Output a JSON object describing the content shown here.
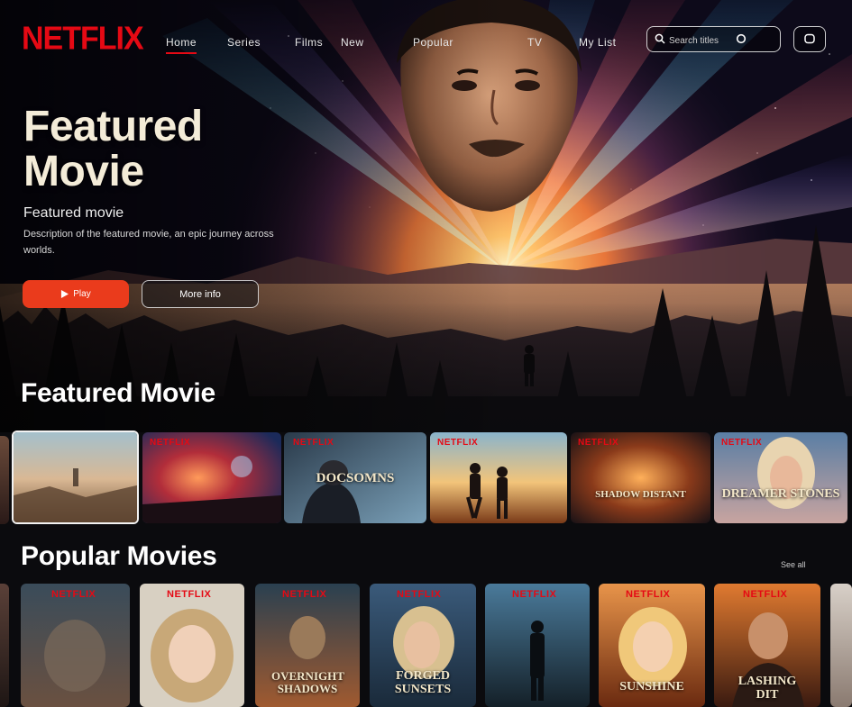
{
  "brand": {
    "logo": "NETFLIX",
    "accent": "#e50914"
  },
  "nav": {
    "links": [
      "Home",
      "Series",
      "Films",
      "New",
      "Popular",
      "TV",
      "My List"
    ]
  },
  "search": {
    "placeholder": "Search titles"
  },
  "hero": {
    "title": "Featured Movie",
    "subtitle": "Featured movie",
    "description": "Description of the featured movie, an epic journey across worlds.",
    "play_label": "Play",
    "more_label": "More info"
  },
  "rows": [
    {
      "title": "Featured Movie",
      "cards": [
        {
          "logo": "",
          "title": ""
        },
        {
          "logo": "NETFLIX",
          "title": ""
        },
        {
          "logo": "NETFLIX",
          "title": "DOCSOMNS"
        },
        {
          "logo": "NETFLIX",
          "title": ""
        },
        {
          "logo": "NETFLIX",
          "title": "SHADOW DISTANT"
        },
        {
          "logo": "NETFLIX",
          "title": "DREAMER STONES"
        }
      ]
    },
    {
      "title": "Popular Movies",
      "see_all": "See all",
      "cards": [
        {
          "logo": "NETFLIX",
          "title": ""
        },
        {
          "logo": "NETFLIX",
          "title": ""
        },
        {
          "logo": "NETFLIX",
          "title": "OVERNIGHT SHADOWS"
        },
        {
          "logo": "NETFLIX",
          "title": "FORGED SUNSETS"
        },
        {
          "logo": "NETFLIX",
          "title": ""
        },
        {
          "logo": "NETFLIX",
          "title": "SUNSHINE"
        },
        {
          "logo": "NETFLIX",
          "title": "LASHING DIT"
        }
      ]
    }
  ]
}
